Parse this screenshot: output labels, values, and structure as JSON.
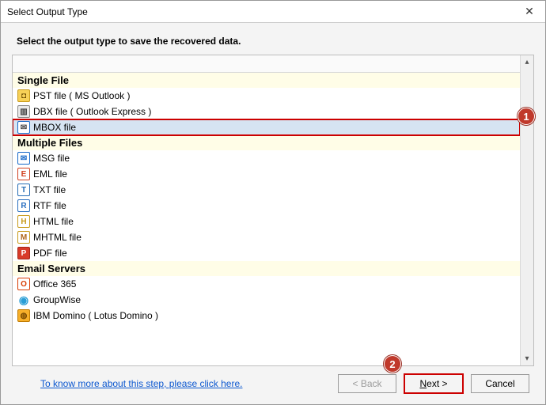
{
  "window": {
    "title": "Select Output Type"
  },
  "instruction": "Select the output type to save the recovered data.",
  "groups": {
    "single": "Single File",
    "multiple": "Multiple Files",
    "servers": "Email Servers"
  },
  "items": {
    "pst": "PST file ( MS Outlook )",
    "dbx": "DBX file ( Outlook Express )",
    "mbox": "MBOX file",
    "msg": "MSG file",
    "eml": "EML file",
    "txt": "TXT file",
    "rtf": "RTF file",
    "html": "HTML file",
    "mhtml": "MHTML file",
    "pdf": "PDF file",
    "o365": "Office 365",
    "gw": "GroupWise",
    "domino": "IBM Domino ( Lotus Domino )"
  },
  "footer": {
    "help_link": "To know more about this step, please click here.",
    "back": "< Back",
    "next_prefix": "N",
    "next_rest": "ext >",
    "cancel": "Cancel"
  },
  "badges": {
    "one": "1",
    "two": "2"
  }
}
